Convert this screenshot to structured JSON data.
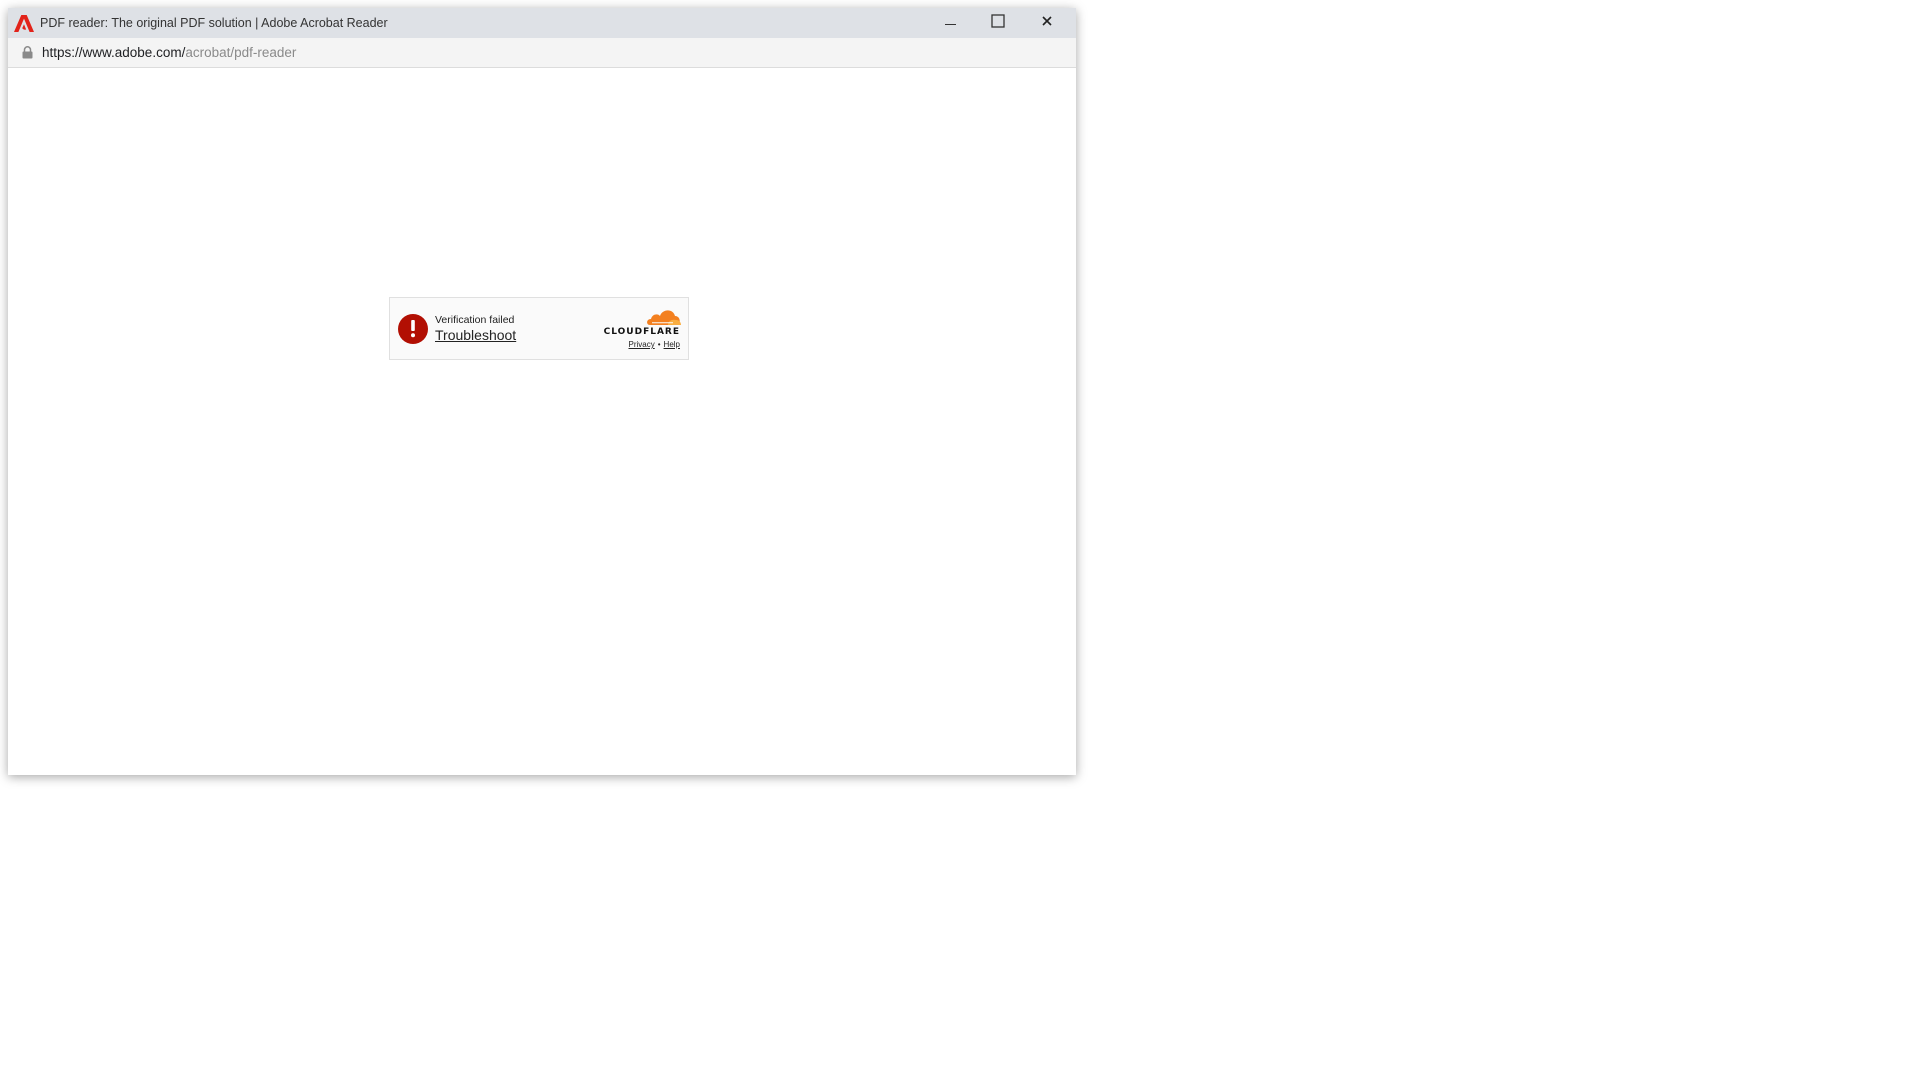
{
  "window": {
    "title": "PDF reader: The original PDF solution | Adobe Acrobat Reader",
    "app_icon": "adobe-acrobat-icon",
    "controls": {
      "minimize": "minimize-icon",
      "maximize": "maximize-icon",
      "close": "close-icon"
    }
  },
  "address_bar": {
    "host": "https://www.adobe.com/",
    "path": "acrobat/pdf-reader",
    "icon": "lock-icon"
  },
  "turnstile": {
    "status_text": "Verification failed",
    "troubleshoot_label": "Troubleshoot",
    "brand": "CLOUDFLARE",
    "privacy_label": "Privacy",
    "separator": "•",
    "help_label": "Help",
    "error_color": "#b20f03",
    "brand_color": "#f38020"
  }
}
